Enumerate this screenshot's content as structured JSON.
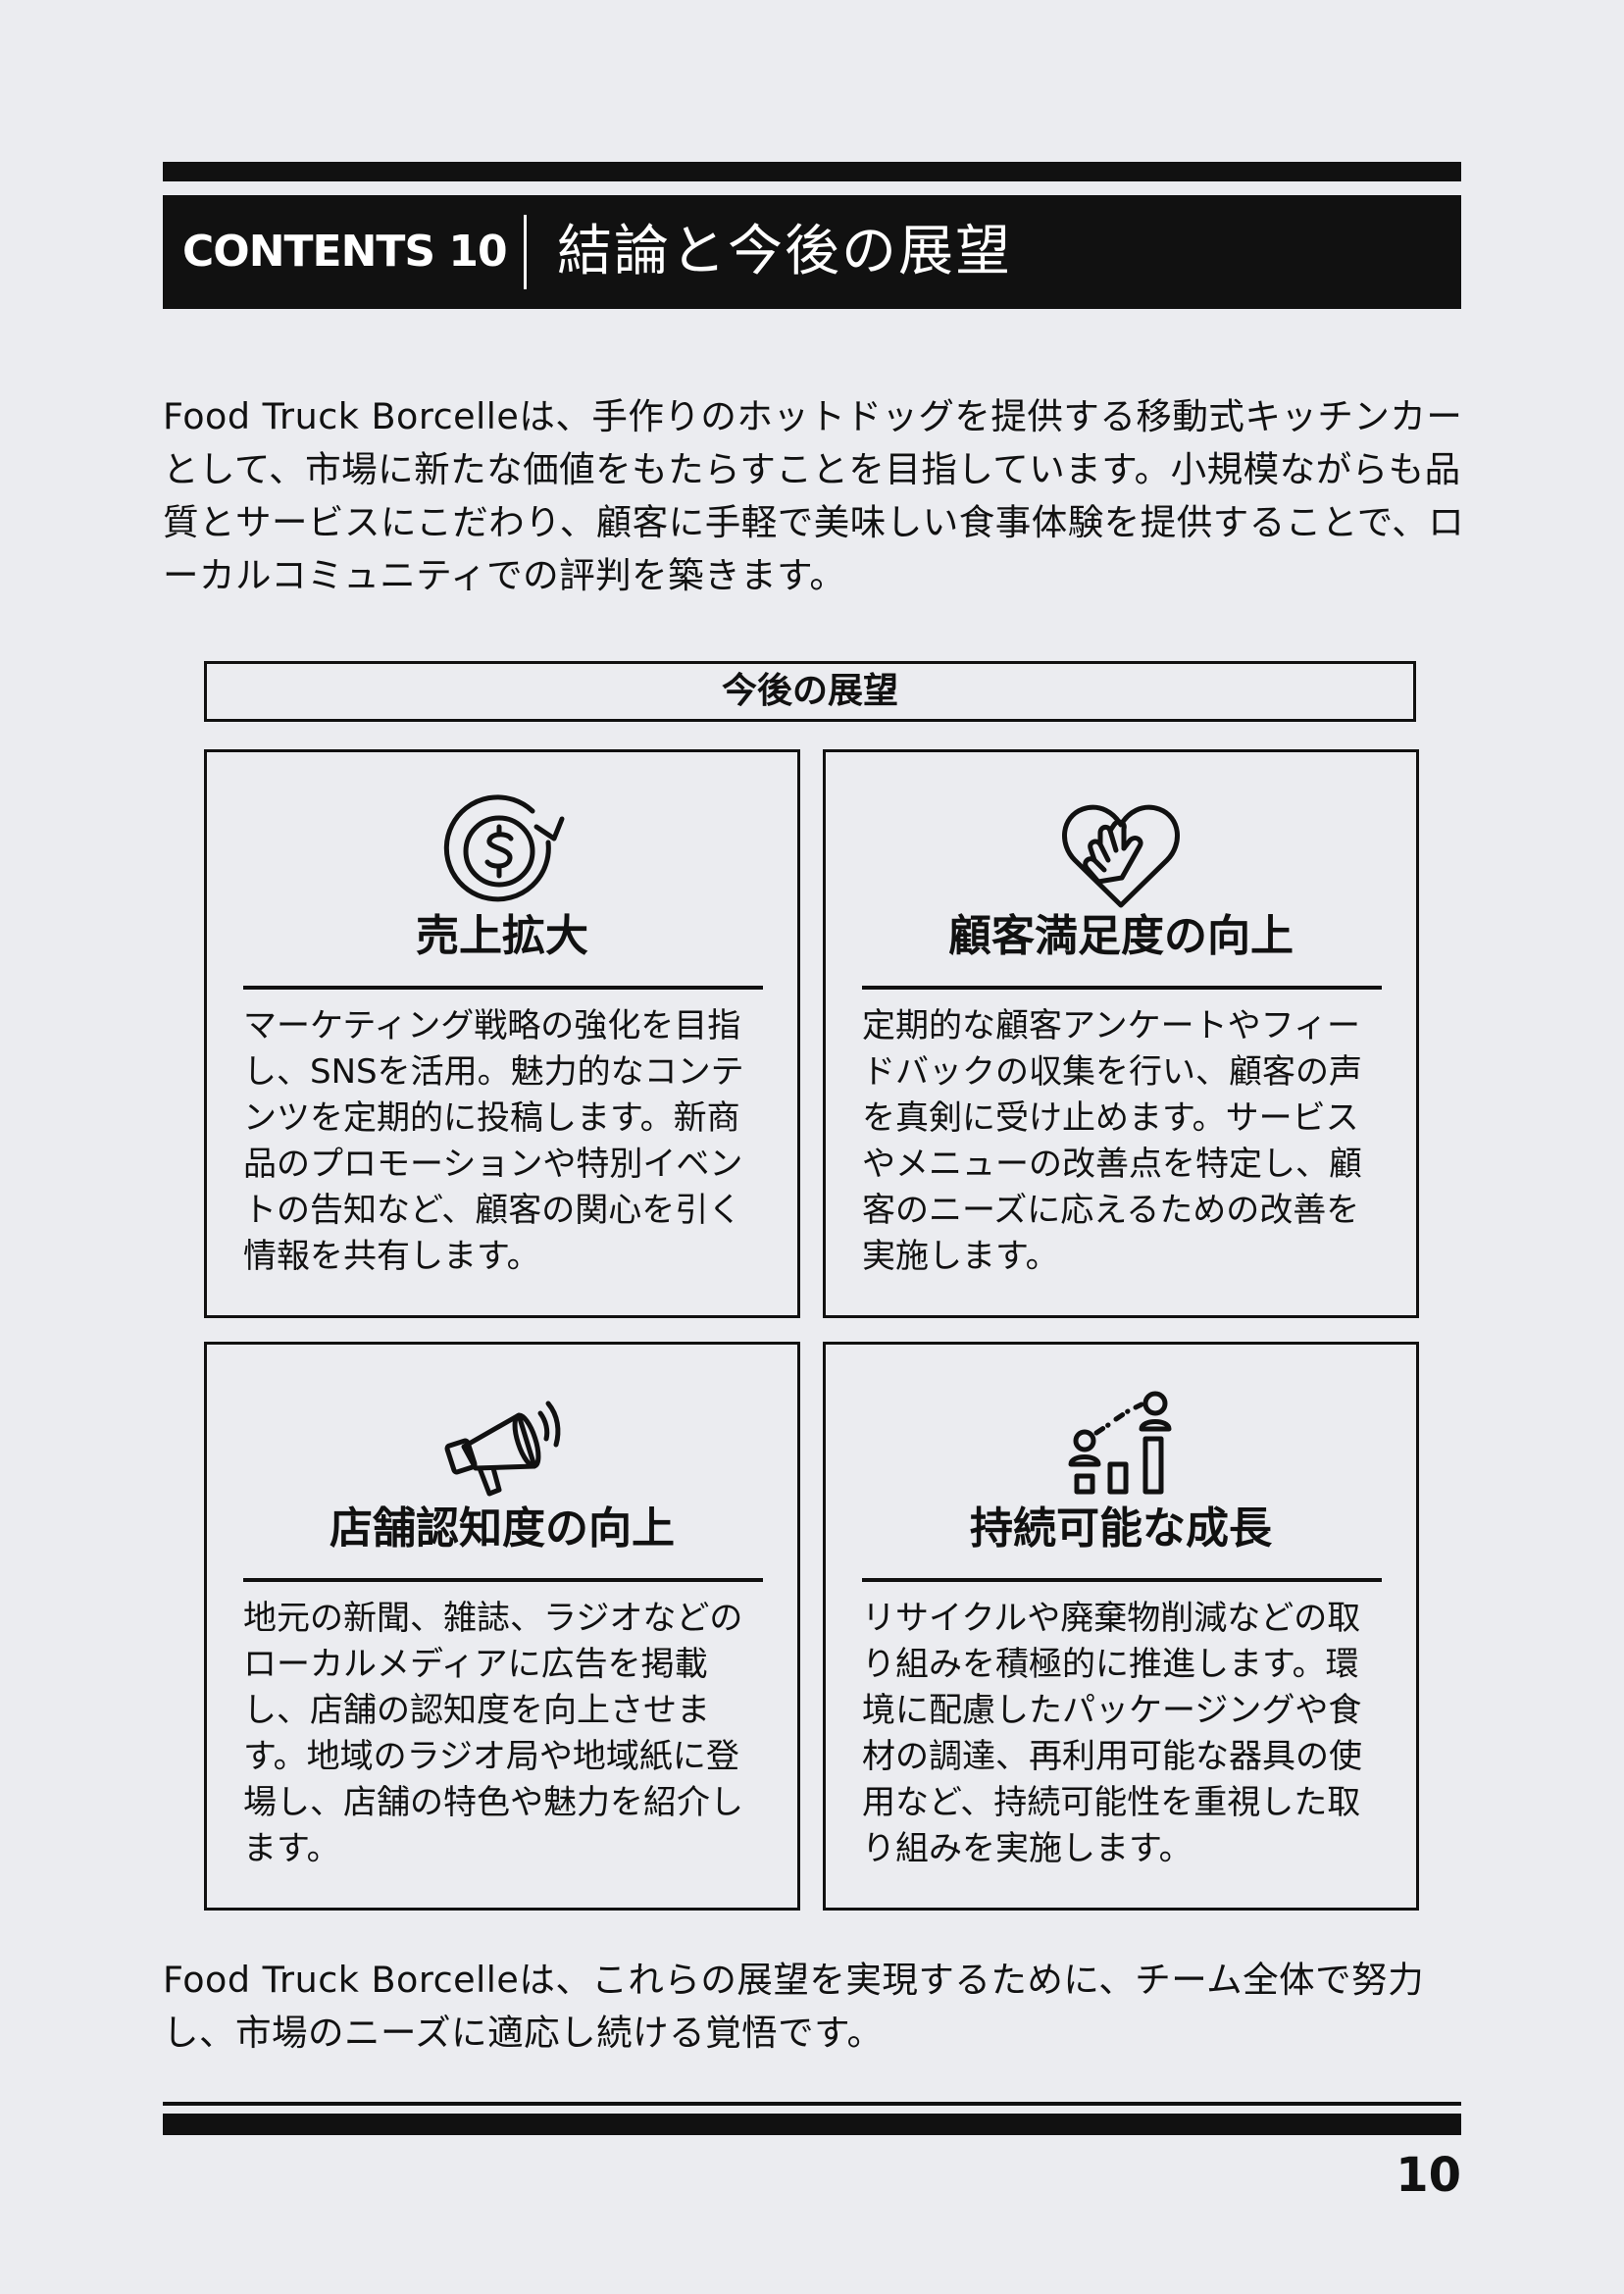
{
  "header": {
    "label": "CONTENTS 10",
    "title": "結論と今後の展望"
  },
  "intro": "Food Truck Borcelleは、手作りのホットドッグを提供する移動式キッチンカーとして、市場に新たな価値をもたらすことを目指しています。小規模ながらも品質とサービスにこだわり、顧客に手軽で美味しい食事体験を提供することで、ローカルコミュニティでの評判を築きます。",
  "outlook": {
    "title": "今後の展望",
    "cards": [
      {
        "icon": "dollar-cycle-icon",
        "title": "売上拡大",
        "body": "マーケティング戦略の強化を目指し、SNSを活用。魅力的なコンテンツを定期的に投稿します。新商品のプロモーションや特別イベントの告知など、顧客の関心を引く情報を共有します。"
      },
      {
        "icon": "heart-hand-icon",
        "title": "顧客満足度の向上",
        "body": "定期的な顧客アンケートやフィードバックの収集を行い、顧客の声を真剣に受け止めます。サービスやメニューの改善点を特定し、顧客のニーズに応えるための改善を実施します。"
      },
      {
        "icon": "megaphone-icon",
        "title": "店舗認知度の向上",
        "body": "地元の新聞、雑誌、ラジオなどのローカルメディアに広告を掲載し、店舗の認知度を向上させます。地域のラジオ局や地域紙に登場し、店舗の特色や魅力を紹介します。"
      },
      {
        "icon": "growth-people-icon",
        "title": "持続可能な成長",
        "body": "リサイクルや廃棄物削減などの取り組みを積極的に推進します。環境に配慮したパッケージングや食材の調達、再利用可能な器具の使用など、持続可能性を重視した取り組みを実施します。"
      }
    ]
  },
  "outro": "Food Truck Borcelleは、これらの展望を実現するために、チーム全体で努力し、市場のニーズに適応し続ける覚悟です。",
  "page_number": "10"
}
